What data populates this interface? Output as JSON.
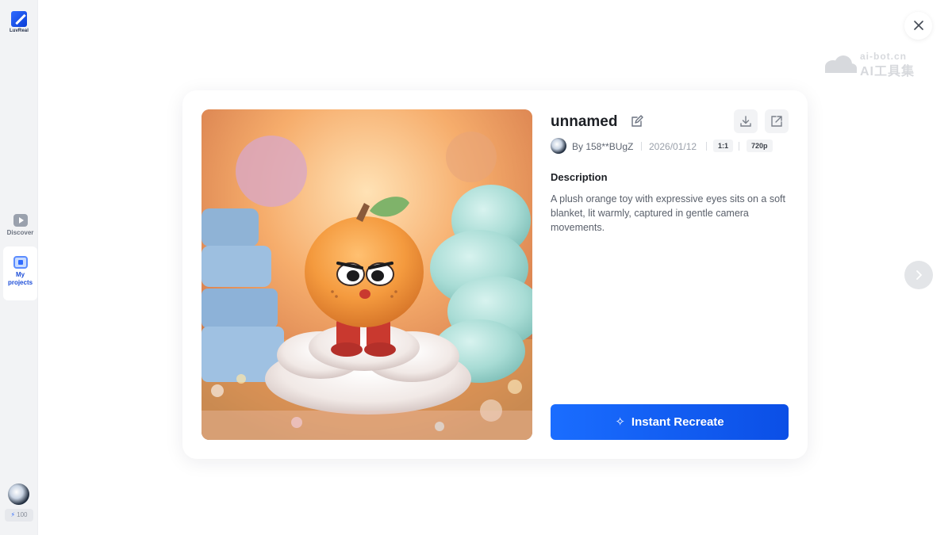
{
  "sidebar": {
    "logo_text": "LuvReal",
    "nav": [
      {
        "label": "Discover",
        "icon": "play-video-icon"
      },
      {
        "label": "My projects",
        "icon": "projects-icon"
      }
    ],
    "credits": "100"
  },
  "watermark": {
    "line1": "ai-bot.cn",
    "line2": "AI工具集"
  },
  "detail": {
    "title": "unnamed",
    "author": "By 158**BUgZ",
    "date": "2026/01/12",
    "ratio": "1:1",
    "resolution": "720p",
    "description_label": "Description",
    "description": "A plush orange toy with expressive eyes sits on a soft blanket, lit warmly, captured in gentle camera movements.",
    "action_label": "Instant Recreate"
  },
  "colors": {
    "accent": "#1a6dff",
    "sidebar_bg": "#f2f3f5",
    "active_nav": "#1d4ed8"
  }
}
